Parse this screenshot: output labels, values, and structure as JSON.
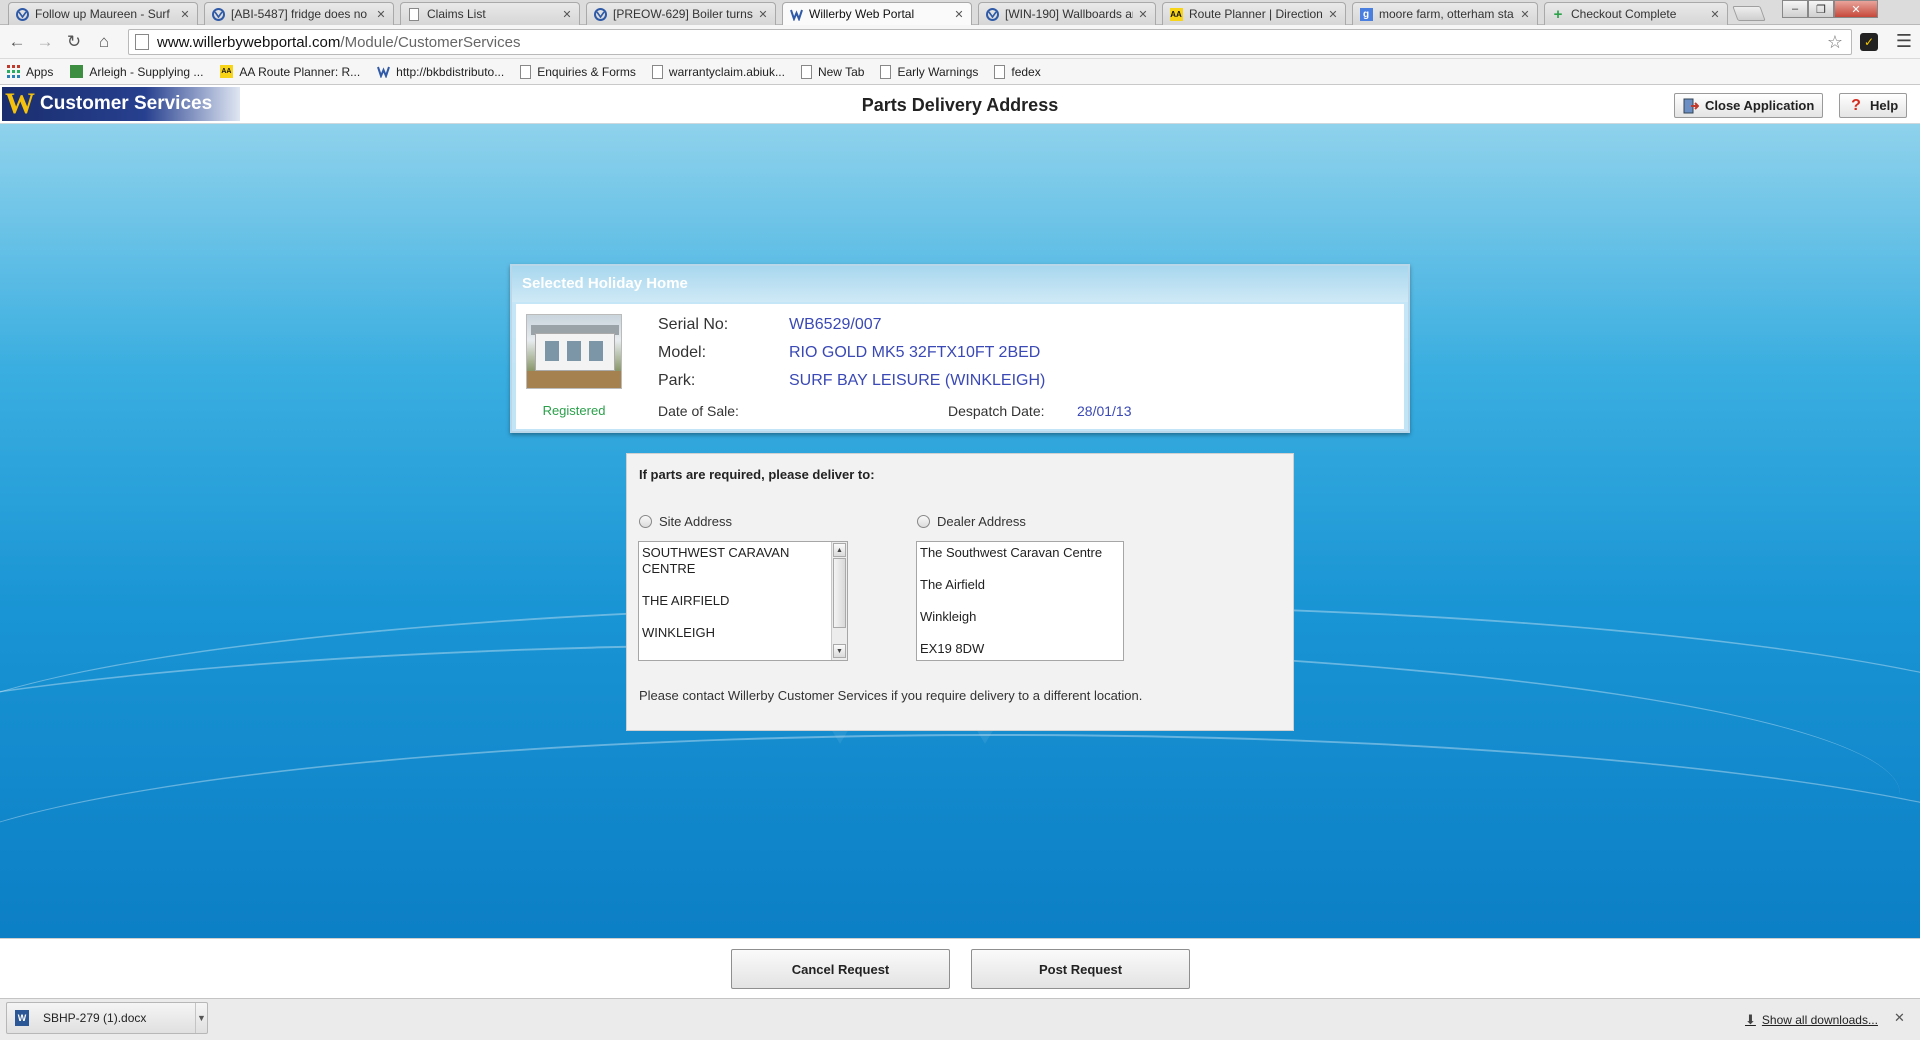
{
  "browser": {
    "tabs": [
      {
        "title": "Follow up Maureen - Surf",
        "icon": "willerby-icon",
        "active": false
      },
      {
        "title": "[ABI-5487] fridge does no",
        "icon": "willerby-icon",
        "active": false
      },
      {
        "title": "Claims List",
        "icon": "page-icon",
        "active": false
      },
      {
        "title": "[PREOW-629] Boiler turns",
        "icon": "willerby-icon",
        "active": false
      },
      {
        "title": "Willerby Web Portal",
        "icon": "willerby-icon",
        "active": true
      },
      {
        "title": "[WIN-190] Wallboards an",
        "icon": "willerby-icon",
        "active": false
      },
      {
        "title": "Route Planner | Direction",
        "icon": "aa-icon",
        "active": false
      },
      {
        "title": "moore farm, otterham sta",
        "icon": "google-icon",
        "active": false
      },
      {
        "title": "Checkout Complete",
        "icon": "plus-icon",
        "active": false
      }
    ],
    "tab_close_glyph": "✕",
    "window_controls": {
      "minimize": "–",
      "restore": "❐",
      "close": "✕"
    },
    "url_host": "www.willerbywebportal.com",
    "url_path": "/Module/CustomerServices",
    "bookmarks": [
      {
        "label": "Apps",
        "icon": "apps-icon"
      },
      {
        "label": "Arleigh - Supplying ...",
        "icon": "arleigh-icon"
      },
      {
        "label": "AA Route Planner: R...",
        "icon": "aa-icon"
      },
      {
        "label": "http://bkbdistributo...",
        "icon": "willerby-icon"
      },
      {
        "label": "Enquiries & Forms",
        "icon": "page-icon"
      },
      {
        "label": "warrantyclaim.abiuk...",
        "icon": "page-icon"
      },
      {
        "label": "New Tab",
        "icon": "page-icon"
      },
      {
        "label": "Early Warnings",
        "icon": "page-icon"
      },
      {
        "label": "fedex",
        "icon": "page-icon"
      }
    ]
  },
  "app": {
    "brand": "Customer Services",
    "title": "Parts Delivery Address",
    "close_app_label": "Close Application",
    "help_label": "Help"
  },
  "holiday_home": {
    "panel_title": "Selected Holiday Home",
    "status": "Registered",
    "serial_label": "Serial No:",
    "serial_value": "WB6529/007",
    "model_label": "Model:",
    "model_value": "RIO GOLD MK5 32FTX10FT 2BED",
    "park_label": "Park:",
    "park_value": "SURF BAY LEISURE (WINKLEIGH)",
    "date_of_sale_label": "Date of Sale:",
    "date_of_sale_value": "",
    "despatch_label": "Despatch Date:",
    "despatch_value": "28/01/13"
  },
  "delivery": {
    "heading": "If parts are required, please deliver to:",
    "site_label": "Site Address",
    "dealer_label": "Dealer Address",
    "site_lines": [
      "SOUTHWEST CARAVAN CENTRE",
      "THE AIRFIELD",
      "WINKLEIGH"
    ],
    "dealer_lines": [
      "The Southwest Caravan Centre",
      "The Airfield",
      "Winkleigh",
      "EX19 8DW"
    ],
    "note": "Please contact Willerby Customer Services if you require delivery to a different location."
  },
  "footer": {
    "cancel_label": "Cancel Request",
    "post_label": "Post Request"
  },
  "downloads": {
    "file_name": "SBHP-279 (1).docx",
    "show_all_label": "Show all downloads..."
  }
}
